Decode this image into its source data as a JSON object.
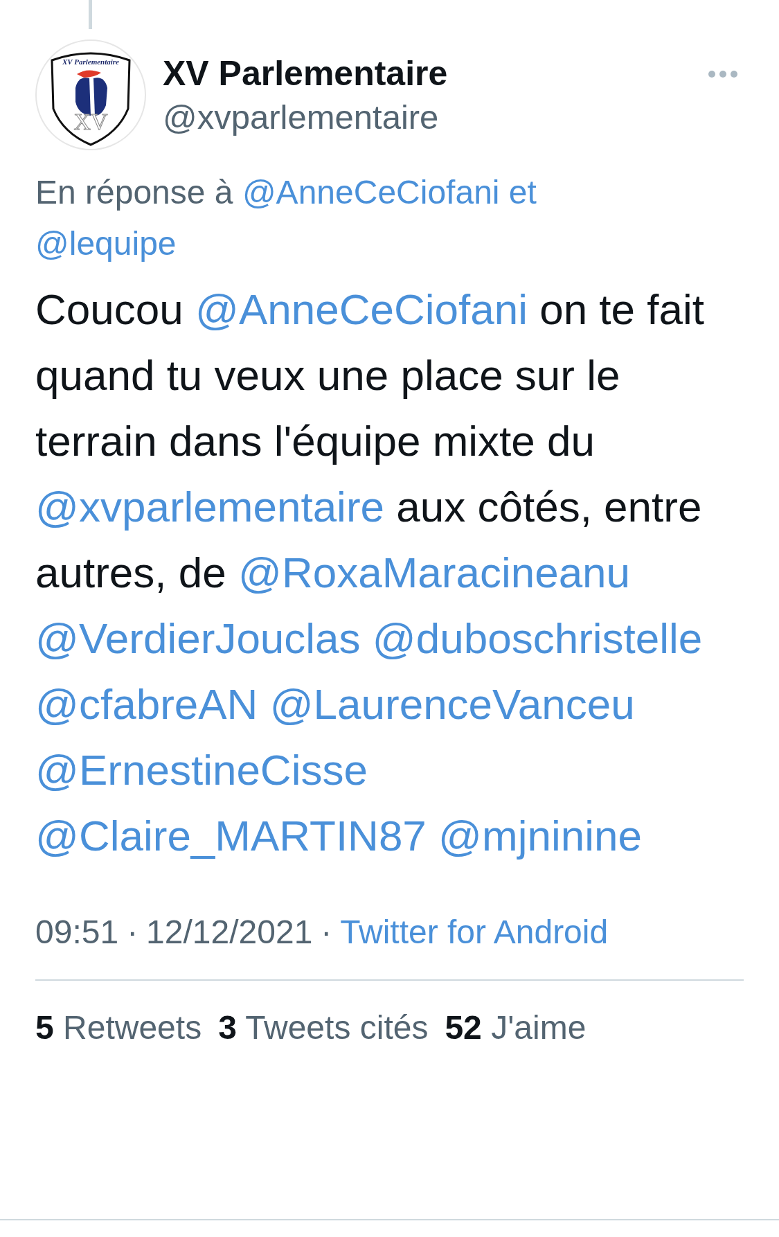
{
  "author": {
    "name": "XV Parlementaire",
    "handle": "@xvparlementaire",
    "logo_text": "XV Parlementaire",
    "logo_mark": "XV"
  },
  "reply_to": {
    "prefix": "En réponse à",
    "mentions": [
      "@AnneCeCiofani",
      "@lequipe"
    ],
    "joiner": "et"
  },
  "body": [
    {
      "kind": "plain",
      "text": "Coucou "
    },
    {
      "kind": "mention",
      "text": "@AnneCeCiofani"
    },
    {
      "kind": "plain",
      "text": " on te fait quand tu veux une place sur le terrain dans l'équipe mixte du "
    },
    {
      "kind": "mention",
      "text": "@xvparlementaire"
    },
    {
      "kind": "plain",
      "text": " aux côtés, entre autres, de "
    },
    {
      "kind": "mention",
      "text": "@RoxaMaracineanu"
    },
    {
      "kind": "mention",
      "text": "@VerdierJouclas"
    },
    {
      "kind": "mention",
      "text": "@duboschristelle"
    },
    {
      "kind": "mention",
      "text": "@cfabreAN"
    },
    {
      "kind": "mention",
      "text": "@LaurenceVanceu"
    },
    {
      "kind": "mention",
      "text": "@ErnestineCisse"
    },
    {
      "kind": "mention",
      "text": "@Claire_MARTIN87"
    },
    {
      "kind": "mention",
      "text": "@mjninine"
    }
  ],
  "meta": {
    "time": "09:51",
    "date": "12/12/2021",
    "separator": "·",
    "source": "Twitter for Android"
  },
  "stats": [
    {
      "count": "5",
      "label": "Retweets"
    },
    {
      "count": "3",
      "label": "Tweets cités"
    },
    {
      "count": "52",
      "label": "J'aime"
    }
  ]
}
